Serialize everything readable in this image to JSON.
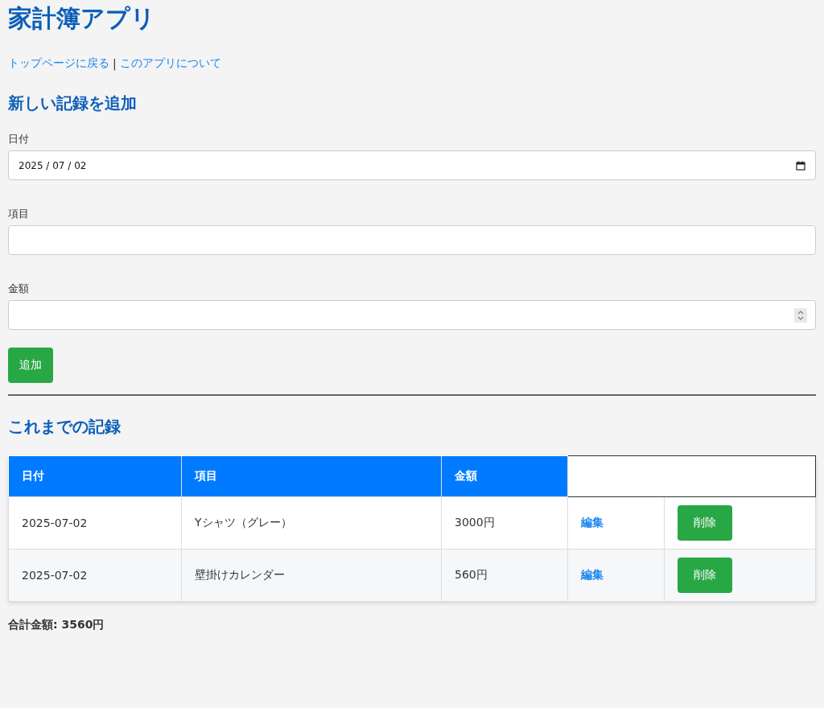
{
  "title": "家計簿アプリ",
  "nav": {
    "links": [
      {
        "label": "トップページに戻る"
      },
      {
        "label": "このアプリについて"
      }
    ],
    "separator": "|"
  },
  "form": {
    "heading": "新しい記録を追加",
    "fields": [
      {
        "label": "日付",
        "kind": "date",
        "value": "2025 / 07 / 02"
      },
      {
        "label": "項目",
        "kind": "text"
      },
      {
        "label": "金額",
        "kind": "number"
      }
    ],
    "submit": "追加"
  },
  "records": {
    "heading": "これまでの記録",
    "columns": [
      "日付",
      "項目",
      "金額"
    ],
    "rows": [
      {
        "date": "2025-07-02",
        "item": "Yシャツ（グレー）",
        "amount": "3000円",
        "edit": "編集",
        "delete": "削除"
      },
      {
        "date": "2025-07-02",
        "item": "壁掛けカレンダー",
        "amount": "560円",
        "edit": "編集",
        "delete": "削除"
      }
    ],
    "total": "合計金額: 3560円"
  }
}
